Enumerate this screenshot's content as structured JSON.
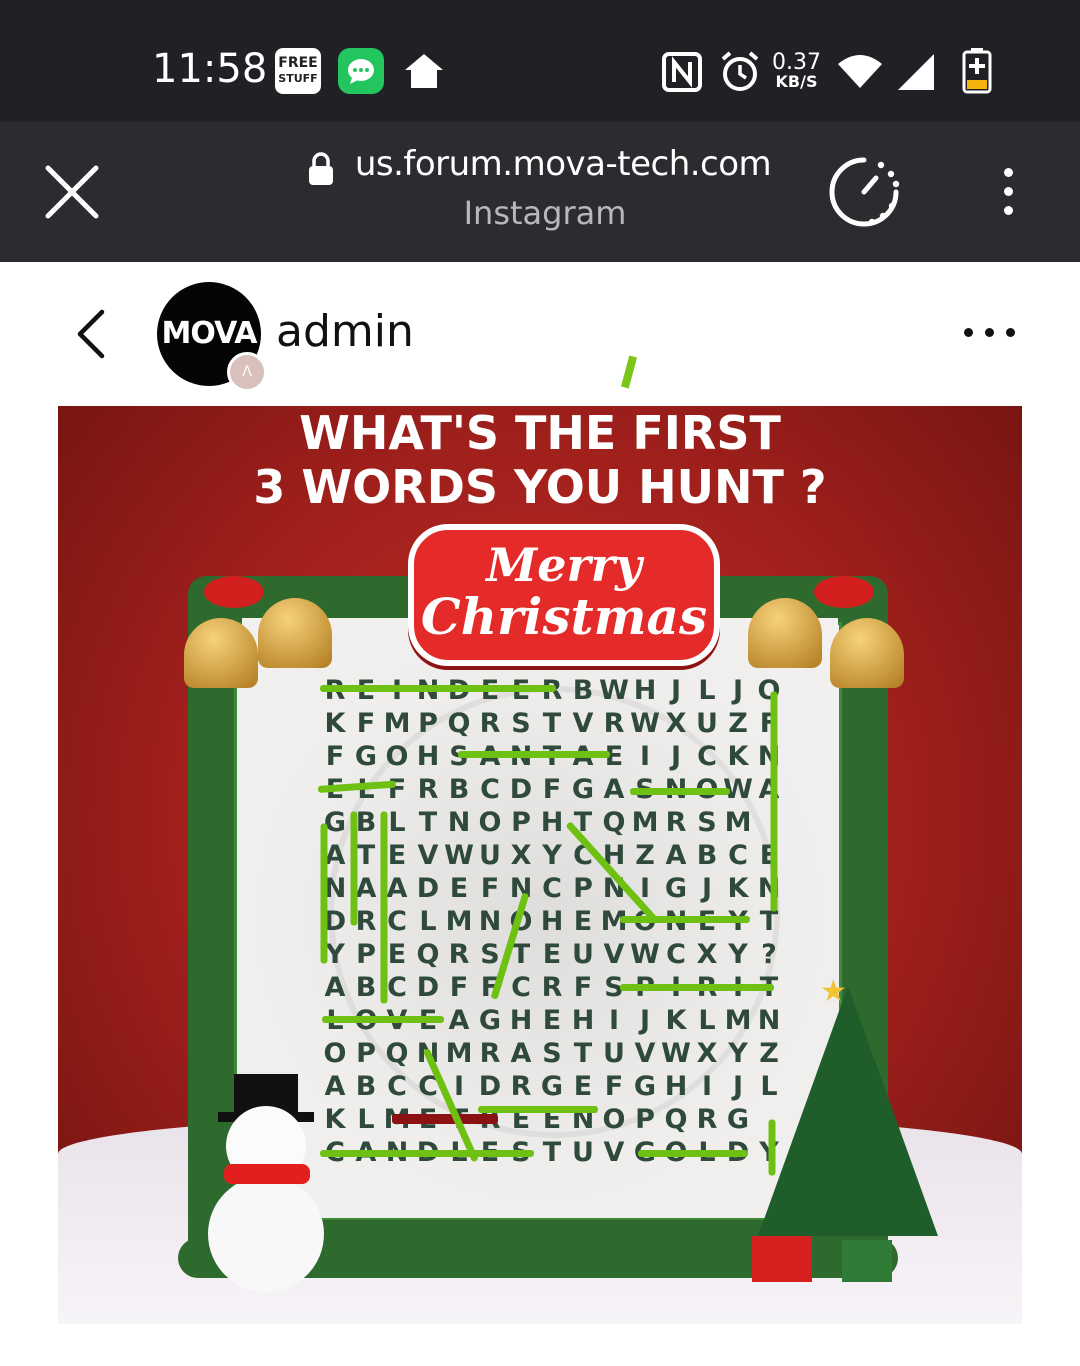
{
  "status_bar": {
    "time": "11:58",
    "free_stuff_line1": "FREE",
    "free_stuff_line2": "STUFF",
    "net_speed": "0.37",
    "net_unit": "KB/S"
  },
  "browser": {
    "url": "us.forum.mova-tech.com",
    "subtitle": "Instagram"
  },
  "post": {
    "avatar_text": "MOVA",
    "username": "admin",
    "image": {
      "headline_line1": "WHAT'S THE FIRST",
      "headline_line2": "3 WORDS YOU HUNT ?",
      "banner_line1": "Merry",
      "banner_line2": "Christmas",
      "grid_rows": [
        "REINDEERBWHJLJO",
        "KFMPQRSTVRWXUZF",
        "FGOHSANTAEIJCKN",
        "ELFRBCDFGASNOWA",
        "GBLTNOPHTQMRSM",
        "ATEVWUXYCHZABCE",
        "NAADEFNCPNIGJKN",
        "DRCLMNOHEMONEYT",
        "YPEQRSTEUVWCXY?",
        "ABCDFFCRFSPIRIT",
        "LOVEAGHEHIJKLMN",
        "OPQNMRASTUVWXYZ",
        "ABCCIDRGEFGHIJL",
        "KLMETREENOPQRG",
        "CANDLESTUVGOLDY"
      ]
    }
  },
  "colors": {
    "status_bar_bg": "#202124",
    "url_bar_bg": "#2b2c2f",
    "highlight_green": "#6ec013",
    "highlight_red": "#8b1212",
    "poster_red": "#b2241f"
  }
}
